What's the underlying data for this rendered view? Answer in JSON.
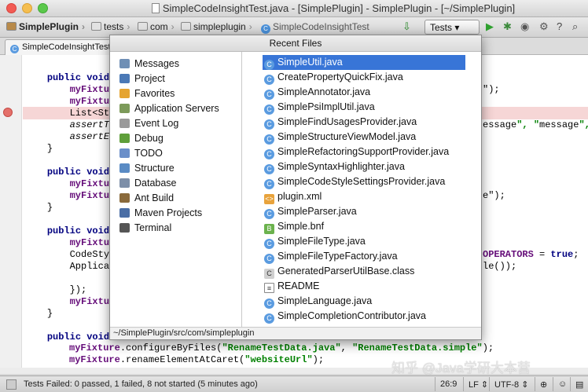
{
  "window": {
    "title": "SimpleCodeInsightTest.java - [SimplePlugin] - SimplePlugin - [~/SimplePlugin]"
  },
  "navbar": {
    "crumbs": [
      "SimplePlugin",
      "tests",
      "com",
      "simpleplugin",
      "SimpleCodeInsightTest"
    ],
    "run_config": "Tests"
  },
  "editor_tab": {
    "label": "SimpleCodeInsightTest.java"
  },
  "code": {
    "lines": [
      {
        "pre": "    ",
        "kw": "public void",
        "rest": ""
      },
      {
        "pre": "        ",
        "fld": "myFixtu",
        "rest": ""
      },
      {
        "pre": "        ",
        "fld": "myFixtu",
        "rest": ""
      },
      {
        "pre": "        ",
        "rest": "List<Str"
      },
      {
        "pre": "        ",
        "it": "assertTr",
        "rest": ""
      },
      {
        "pre": "        ",
        "it": "assertEq",
        "rest": ""
      },
      {
        "pre": "    ",
        "rest": "}"
      },
      {
        "pre": "",
        "rest": ""
      },
      {
        "pre": "    ",
        "kw": "public void",
        "rest": ""
      },
      {
        "pre": "        ",
        "fld": "myFixtu",
        "rest": ""
      },
      {
        "pre": "        ",
        "fld": "myFixtu",
        "rest": ""
      },
      {
        "pre": "    ",
        "rest": "}"
      },
      {
        "pre": "",
        "rest": ""
      },
      {
        "pre": "    ",
        "kw": "public void",
        "rest": ""
      },
      {
        "pre": "        ",
        "fld": "myFixtu",
        "rest": ""
      },
      {
        "pre": "        ",
        "rest": "CodeSty"
      },
      {
        "pre": "        ",
        "rest": "Applica"
      },
      {
        "pre": "",
        "rest": ""
      },
      {
        "pre": "        ",
        "rest": "});"
      },
      {
        "pre": "        ",
        "fld": "myFixtu",
        "rest": ""
      },
      {
        "pre": "    ",
        "rest": "}"
      },
      {
        "pre": "",
        "rest": ""
      },
      {
        "pre": "    ",
        "kw": "public void",
        "rest": ""
      }
    ],
    "right_fragments": [
      {
        "line": 1,
        "text": "\");"
      },
      {
        "line": 4,
        "text": "essage\", \"message\", \""
      },
      {
        "line": 10,
        "text": "e\");"
      },
      {
        "line": 15,
        "text": "OPERATORS = true;"
      },
      {
        "line": 16,
        "text": "le());"
      }
    ],
    "bottom_lines": [
      {
        "field": "myFixture",
        "call": ".configureByFiles(",
        "arg1": "\"RenameTestData.java\"",
        "sep": ", ",
        "arg2": "\"RenameTestData.simple\"",
        "end": ");"
      },
      {
        "field": "myFixture",
        "call": ".renameElementAtCaret(",
        "arg1": "\"websiteUrl\"",
        "sep": "",
        "arg2": "",
        "end": ");"
      }
    ]
  },
  "switcher": {
    "header": "Recent Files",
    "tool_windows": [
      {
        "label": "Messages",
        "icon": "messages-icon",
        "color": "#6f8fb5"
      },
      {
        "label": "Project",
        "icon": "project-icon",
        "color": "#4b79b6"
      },
      {
        "label": "Favorites",
        "icon": "favorites-icon",
        "color": "#e5a430"
      },
      {
        "label": "Application Servers",
        "icon": "server-icon",
        "color": "#7c9a5a"
      },
      {
        "label": "Event Log",
        "icon": "event-log-icon",
        "color": "#9a9a9a"
      },
      {
        "label": "Debug",
        "icon": "debug-icon",
        "color": "#5f9f3a"
      },
      {
        "label": "TODO",
        "icon": "todo-icon",
        "color": "#6b8fc9"
      },
      {
        "label": "Structure",
        "icon": "structure-icon",
        "color": "#5a8bc4"
      },
      {
        "label": "Database",
        "icon": "database-icon",
        "color": "#7d8fa8"
      },
      {
        "label": "Ant Build",
        "icon": "ant-icon",
        "color": "#8a6a3b"
      },
      {
        "label": "Maven Projects",
        "icon": "maven-icon",
        "color": "#4a6ea5"
      },
      {
        "label": "Terminal",
        "icon": "terminal-icon",
        "color": "#555555"
      }
    ],
    "recent_files": [
      {
        "label": "SimpleUtil.java",
        "type": "java",
        "selected": true
      },
      {
        "label": "CreatePropertyQuickFix.java",
        "type": "java"
      },
      {
        "label": "SimpleAnnotator.java",
        "type": "java"
      },
      {
        "label": "SimplePsiImplUtil.java",
        "type": "java"
      },
      {
        "label": "SimpleFindUsagesProvider.java",
        "type": "java"
      },
      {
        "label": "SimpleStructureViewModel.java",
        "type": "java"
      },
      {
        "label": "SimpleRefactoringSupportProvider.java",
        "type": "java"
      },
      {
        "label": "SimpleSyntaxHighlighter.java",
        "type": "java"
      },
      {
        "label": "SimpleCodeStyleSettingsProvider.java",
        "type": "java"
      },
      {
        "label": "plugin.xml",
        "type": "xml"
      },
      {
        "label": "SimpleParser.java",
        "type": "java"
      },
      {
        "label": "Simple.bnf",
        "type": "bnf"
      },
      {
        "label": "SimpleFileType.java",
        "type": "java"
      },
      {
        "label": "SimpleFileTypeFactory.java",
        "type": "java"
      },
      {
        "label": "GeneratedParserUtilBase.class",
        "type": "class"
      },
      {
        "label": "README",
        "type": "text"
      },
      {
        "label": "SimpleLanguage.java",
        "type": "java"
      },
      {
        "label": "SimpleCompletionContributor.java",
        "type": "java"
      }
    ],
    "footer_path": "~/SimplePlugin/src/com/simpleplugin"
  },
  "statusbar": {
    "message": "Tests Failed: 0 passed, 1 failed, 8 not started (5 minutes ago)",
    "position": "26:9",
    "line_separator": "LF",
    "encoding": "UTF-8"
  },
  "watermark": "知乎 @Java学研大本营"
}
